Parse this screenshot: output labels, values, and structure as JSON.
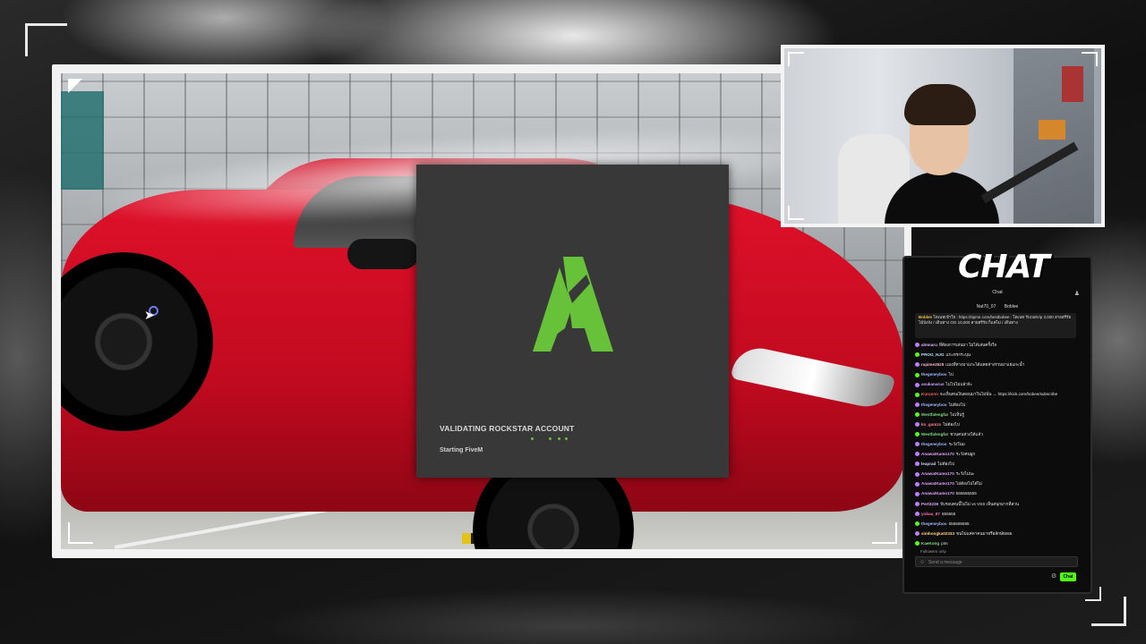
{
  "loader": {
    "title": "VALIDATING ROCKSTAR ACCOUNT",
    "status": "Starting FiveM",
    "accent": "#67c23a"
  },
  "chat": {
    "brand": "CHAT",
    "header": "Chat",
    "pinned_users": [
      "Nat70_07",
      "Boblee"
    ],
    "pinned_message": {
      "user": "Boblee",
      "text": "โดเนทเข้าใจ : https://tipme.com/bestbobee : โดเนท รับเบสVip 3,000 สายสรีรัยไม้บังจัง / เดินทาง OG 10,000 สายสรีรัย ก็แค่ไม่ / เดินทาง"
    },
    "messages": [
      {
        "user": "almnaru",
        "text": "ที่ต้องการเล่นมา ไม่ได้เล่นครั้งใจ",
        "color": "#e0b0ff",
        "badge": "#c07cff"
      },
      {
        "user": "PROG_NJG",
        "text": "แกะทรกระบุน",
        "color": "#b0e0ff",
        "badge": "#53fc18"
      },
      {
        "user": "rapime2525",
        "text": "แมงที่ห่างมาแกะได้แคยห่างรวบมาแย่แกะน้ำ",
        "color": "#ffb0d0",
        "badge": "#c07cff"
      },
      {
        "user": "thegeneyboo",
        "text": "ไป",
        "color": "#9fb6ff",
        "badge": "#53fc18"
      },
      {
        "user": "asukanarus",
        "text": "ไม่ไปไม่แล้วจ้ะ",
        "color": "#d0a0ff",
        "badge": "#c07cff"
      },
      {
        "user": "Kuruson",
        "text": "จะเห็นคนเงินดอนมาในไม่นั่น → https://kick.com/bobee/subscribe",
        "color": "#ff5c5c",
        "badge": "#53fc18"
      },
      {
        "user": "thegeneyboo",
        "text": "ไม่ต้องไป",
        "color": "#9fb6ff",
        "badge": "#c07cff"
      },
      {
        "user": "Westfalengfar",
        "text": "ไม่เห็นรู้",
        "color": "#7fdc7f",
        "badge": "#53fc18"
      },
      {
        "user": "kn_gamzs",
        "text": "ไม่ต้องไป",
        "color": "#ff7f7f",
        "badge": "#c07cff"
      },
      {
        "user": "Westfalengfar",
        "text": "ชวนคนห่วงได้แล้ว",
        "color": "#7fdc7f",
        "badge": "#53fc18"
      },
      {
        "user": "thegeneyboo",
        "text": "ระวังในม",
        "color": "#9fb6ff",
        "badge": "#c07cff"
      },
      {
        "user": "AnawatKamo170",
        "text": "ระวังคนผูก",
        "color": "#e0a0ff",
        "badge": "#c07cff"
      },
      {
        "user": "leaprad",
        "text": "ไม่ต้องไป",
        "color": "#d0d0ff",
        "badge": "#c07cff"
      },
      {
        "user": "AnawatKamo170",
        "text": "ระวังไม่นะ",
        "color": "#e0a0ff",
        "badge": "#c07cff"
      },
      {
        "user": "AnawatKamo170",
        "text": "ไม่ต้องไปได้ไม่",
        "color": "#e0a0ff",
        "badge": "#c07cff"
      },
      {
        "user": "AnawatKamo170",
        "text": "555555555",
        "color": "#e0a0ff",
        "badge": "#c07cff"
      },
      {
        "user": "Pert3236",
        "text": "จับรอบคนนี้ไม่ไม่ vs VSS เห็นสนุกมากที่สวน",
        "color": "#e0a0ff",
        "badge": "#c07cff"
      },
      {
        "user": "yobaa_87",
        "text": "555555",
        "color": "#ff66aa",
        "badge": "#c07cff"
      },
      {
        "user": "thegeneyboo",
        "text": "555555555",
        "color": "#9fb6ff",
        "badge": "#53fc18"
      },
      {
        "user": "simhongka02333",
        "text": "ขนไม่แค่หาคนมาหรือลักษ์5555",
        "color": "#ffd080",
        "badge": "#c07cff"
      },
      {
        "user": "KaeKong",
        "text": "pim",
        "color": "#7fdc7f",
        "badge": "#53fc18"
      }
    ],
    "followers_label": "Followers only",
    "input_placeholder": "Send a message",
    "send_label": "Chat"
  }
}
